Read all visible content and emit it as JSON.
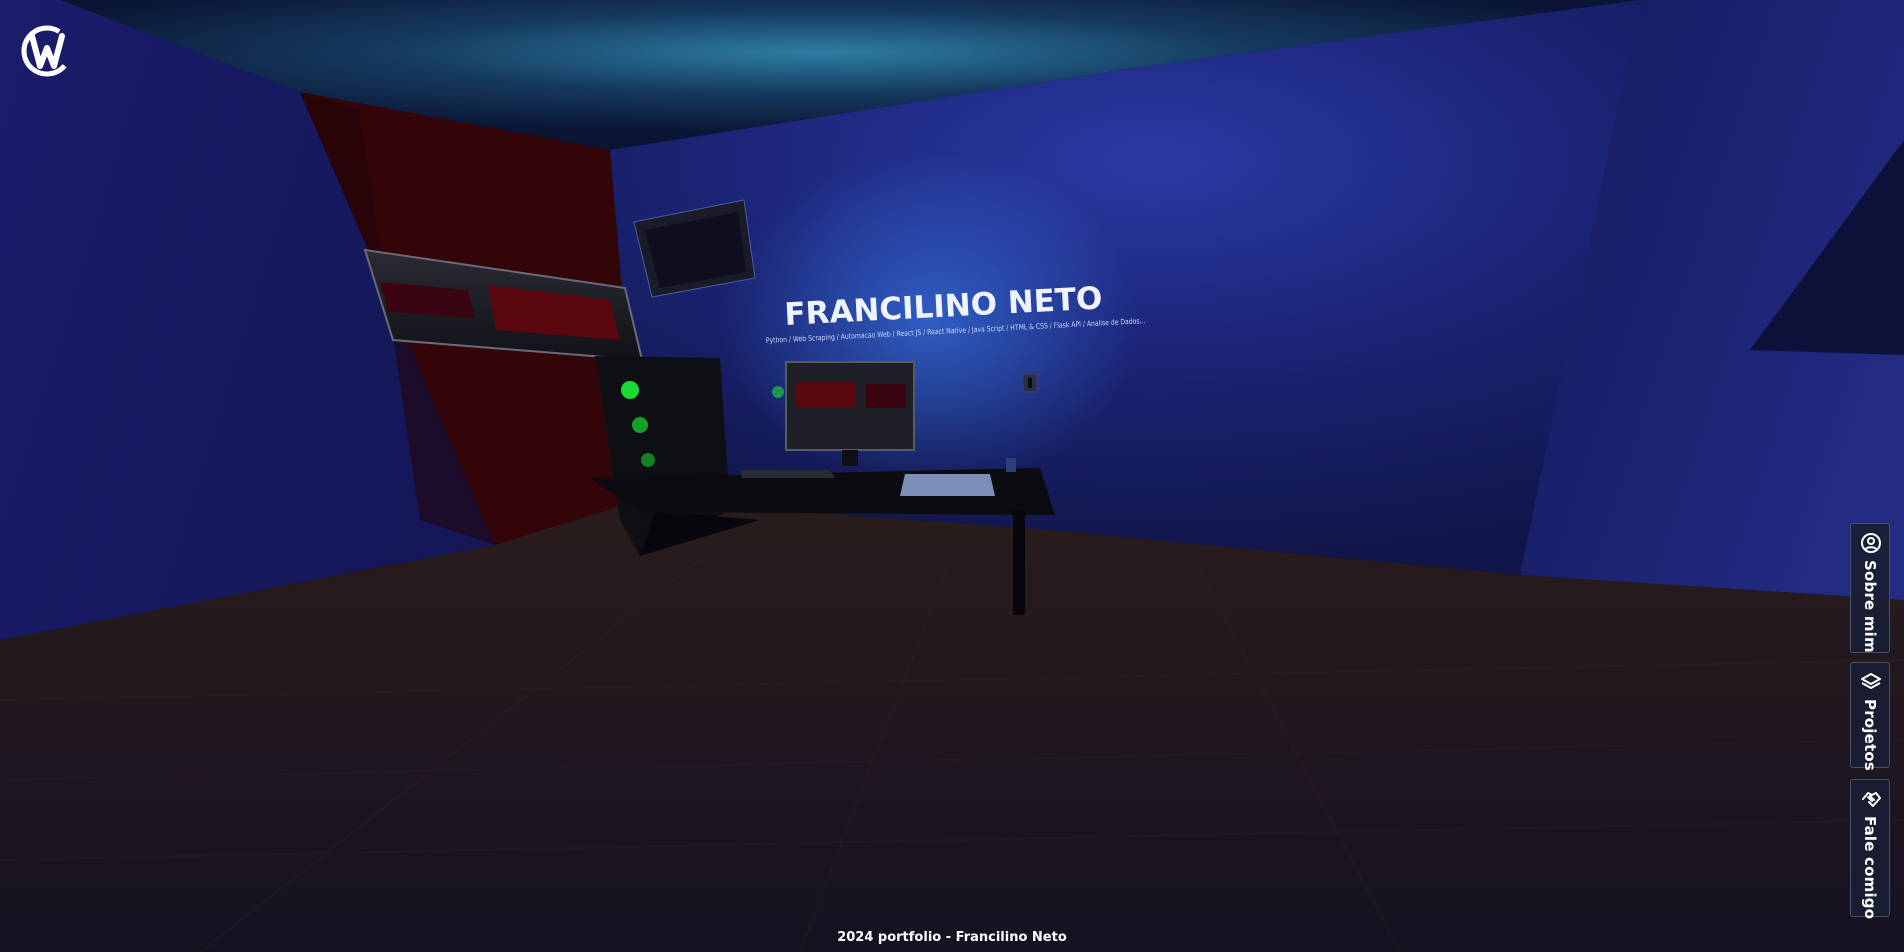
{
  "hero": {
    "name": "FRANCILINO NETO",
    "skills": "Python / Web Scraping / Automacao Web / React JS / React Native / Java Script / HTML & CSS / Flask API / Analise de Dados..."
  },
  "nav": {
    "items": [
      {
        "label": "Sobre mim",
        "icon": "user-circle-icon"
      },
      {
        "label": "Projetos",
        "icon": "layers-icon"
      },
      {
        "label": "Fale comigo",
        "icon": "handshake-icon"
      }
    ]
  },
  "footer": {
    "text": "2024 portfolio - Francilino Neto"
  },
  "colors": {
    "wall": "#1b1f6b",
    "floor": "#1c1621",
    "accent_red": "#3a0408",
    "glow": "#2c6cff",
    "pc_green": "#1cff3a"
  }
}
